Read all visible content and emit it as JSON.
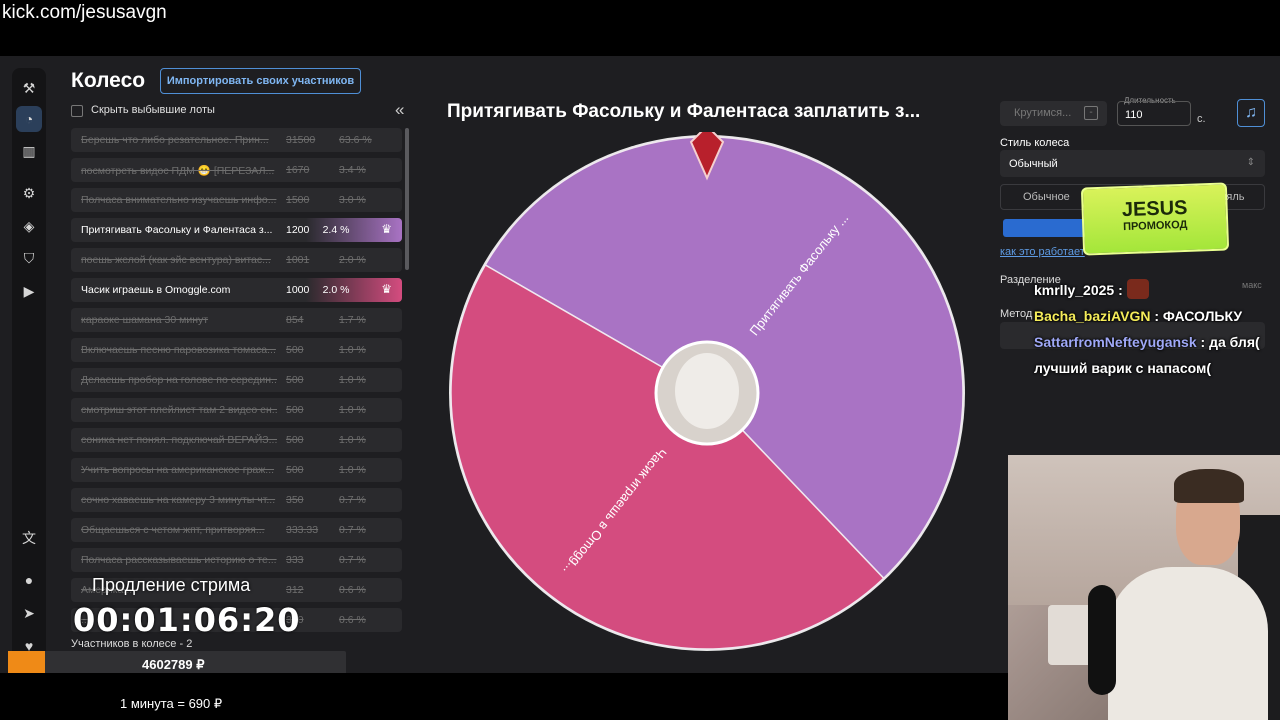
{
  "browser": {
    "url": "kick.com/jesusavgn"
  },
  "page": {
    "title": "Колесо",
    "import_button": "Импортировать своих участников",
    "hide_out_label": "Скрыть выбывшие лоты",
    "collapse_icon": "double-chevron-left-icon"
  },
  "rail": [
    {
      "name": "gavel-icon",
      "glyph": "⚒"
    },
    {
      "name": "wheel-icon",
      "glyph": "◔",
      "active": true
    },
    {
      "name": "stats-icon",
      "glyph": "▥"
    },
    {
      "name": "gear-icon",
      "glyph": "⚙"
    },
    {
      "name": "layers-icon",
      "glyph": "◈"
    },
    {
      "name": "shield-icon",
      "glyph": "⛉"
    },
    {
      "name": "video-icon",
      "glyph": "▶"
    },
    {
      "name": "translate-icon",
      "glyph": "文"
    },
    {
      "name": "github-icon",
      "glyph": "●"
    },
    {
      "name": "telegram-icon",
      "glyph": "➤"
    },
    {
      "name": "donate-icon",
      "glyph": "♥"
    }
  ],
  "lots": [
    {
      "name": "Берешь что либо резательное. Прин...",
      "amount": "31500",
      "percent": "63.6 %",
      "state": "out"
    },
    {
      "name": "посмотреть видос ПДМ 😁 [ПЕРЕЗАЛ...",
      "amount": "1670",
      "percent": "3.4 %",
      "state": "out"
    },
    {
      "name": "Полчаса внимательно изучаешь инфо...",
      "amount": "1500",
      "percent": "3.0 %",
      "state": "out"
    },
    {
      "name": "Притягивать Фасольку и Фалентаса з...",
      "amount": "1200",
      "percent": "2.4 %",
      "state": "active",
      "color": "#a973c4"
    },
    {
      "name": "поешь желой (как эйс вентура) витас...",
      "amount": "1001",
      "percent": "2.0 %",
      "state": "out"
    },
    {
      "name": "Часик играешь в Omoggle.com",
      "amount": "1000",
      "percent": "2.0 %",
      "state": "active",
      "color": "#d44c7f"
    },
    {
      "name": "караоке шамана 30 минут",
      "amount": "854",
      "percent": "1.7 %",
      "state": "out"
    },
    {
      "name": "Включаешь песню паровозика томаса...",
      "amount": "500",
      "percent": "1.0 %",
      "state": "out"
    },
    {
      "name": "Делаешь пробор на голове по середин...",
      "amount": "500",
      "percent": "1.0 %",
      "state": "out"
    },
    {
      "name": "смотриш этот плейлист там 2 видео ен...",
      "amount": "500",
      "percent": "1.0 %",
      "state": "out"
    },
    {
      "name": "соника нет понял. подключай ВЕРАЙЗ...",
      "amount": "500",
      "percent": "1.0 %",
      "state": "out"
    },
    {
      "name": "Учить вопросы на американское граж...",
      "amount": "500",
      "percent": "1.0 %",
      "state": "out"
    },
    {
      "name": "сочно хаваешь на камеру 3 минуты чт...",
      "amount": "350",
      "percent": "0.7 %",
      "state": "out"
    },
    {
      "name": "Общаешься с четом жпт, притворяя...",
      "amount": "333.33",
      "percent": "0.7 %",
      "state": "out"
    },
    {
      "name": "Полчаса рассказываешь историю о те...",
      "amount": "333",
      "percent": "0.7 %",
      "state": "out"
    },
    {
      "name": "Америка...",
      "amount": "312",
      "percent": "0.6 %",
      "state": "out"
    },
    {
      "name": "...",
      "amount": "300",
      "percent": "0.6 %",
      "state": "out"
    }
  ],
  "footer": {
    "participants": "Участников в колесе - 2",
    "total": "4602789 ₽",
    "rate": "1 минута = 690 ₽",
    "extension_label": "Продление стрима",
    "extension_timer": "00:01:06:20"
  },
  "wheel": {
    "title": "Притягивать Фасольку и Фалентаса заплатить з...",
    "segments": [
      {
        "label": "Притягивать Фасольку ...",
        "value": 1200,
        "color": "#a973c4"
      },
      {
        "label": "Часик играешь в Omogg...",
        "value": 1000,
        "color": "#d44c7f"
      }
    ],
    "pointer_icon": "gem-pointer-icon"
  },
  "controls": {
    "spin_button": "Крутимся...",
    "spin_minus": "-",
    "duration_label": "Длительность",
    "duration_value": "110",
    "duration_unit": "с.",
    "music_icon": "music-note-icon",
    "style_label": "Стиль колеса",
    "style_value": "Обычный",
    "mode_a": "Обычное",
    "mode_b": "ляль",
    "how_link": "как это работает",
    "split_label": "Разделение",
    "split_max": "макс",
    "method_label": "Метод"
  },
  "promo": {
    "line1": "JESUS",
    "line2": "ПРОМОКОД"
  },
  "chat": [
    {
      "user": "kmrlly_2025",
      "text": "",
      "color": "#ffffff",
      "emote": true
    },
    {
      "user": "Bacha_baziAVGN",
      "text": "ФАСОЛЬКУ",
      "color": "#f5ec5a"
    },
    {
      "user": "SattarfromNefteyugansk",
      "text": "да бля( лучший варик с напасом(",
      "color": "#9fa8f7"
    }
  ]
}
